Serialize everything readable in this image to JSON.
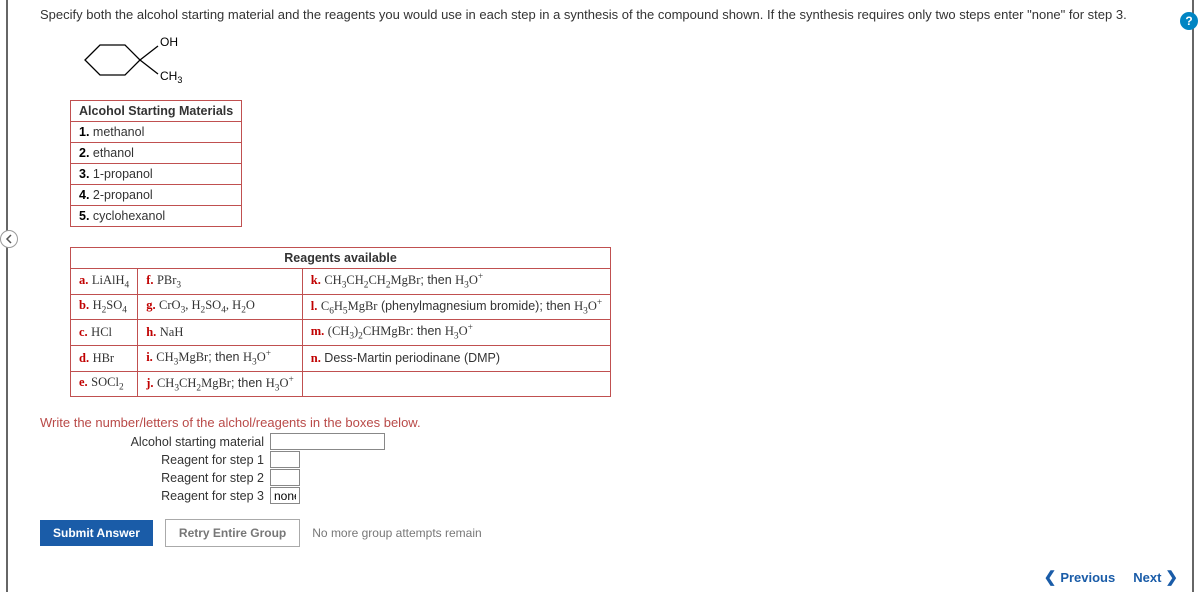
{
  "question": "Specify both the alcohol starting material and the reagents you would use in each step in a synthesis of the compound shown. If the synthesis requires only two steps enter \"none\" for step 3.",
  "structure": {
    "oh": "OH",
    "ch3": "CH₃"
  },
  "materials": {
    "header": "Alcohol Starting Materials",
    "rows": [
      {
        "num": "1.",
        "name": "methanol"
      },
      {
        "num": "2.",
        "name": "ethanol"
      },
      {
        "num": "3.",
        "name": "1-propanol"
      },
      {
        "num": "4.",
        "name": "2-propanol"
      },
      {
        "num": "5.",
        "name": "cyclohexanol"
      }
    ]
  },
  "reagents": {
    "header": "Reagents available",
    "rows": [
      {
        "c1l": "a.",
        "c1t": "LiAlH₄",
        "c2l": "f.",
        "c2t": "PBr₃",
        "c3l": "k.",
        "c3t": "CH₃CH₂CH₂MgBr; then H₃O⁺"
      },
      {
        "c1l": "b.",
        "c1t": "H₂SO₄",
        "c2l": "g.",
        "c2t": "CrO₃, H₂SO₄, H₂O",
        "c3l": "l.",
        "c3t": "C₆H₅MgBr (phenylmagnesium bromide); then H₃O⁺"
      },
      {
        "c1l": "c.",
        "c1t": "HCl",
        "c2l": "h.",
        "c2t": "NaH",
        "c3l": "m.",
        "c3t": "(CH₃)₂CHMgBr: then H₃O⁺"
      },
      {
        "c1l": "d.",
        "c1t": "HBr",
        "c2l": "i.",
        "c2t": "CH₃MgBr; then H₃O⁺",
        "c3l": "n.",
        "c3t": "Dess-Martin periodinane (DMP)"
      },
      {
        "c1l": "e.",
        "c1t": "SOCl₂",
        "c2l": "j.",
        "c2t": "CH₃CH₂MgBr; then H₃O⁺",
        "c3l": "",
        "c3t": ""
      }
    ]
  },
  "instruction": "Write the number/letters of the alchol/reagents in the boxes below.",
  "answers": {
    "starting_label": "Alcohol starting material",
    "step1_label": "Reagent for step 1",
    "step2_label": "Reagent for step 2",
    "step3_label": "Reagent for step 3",
    "starting_value": "",
    "step1_value": "",
    "step2_value": "",
    "step3_value": "none"
  },
  "buttons": {
    "submit": "Submit Answer",
    "retry": "Retry Entire Group",
    "attempts": "No more group attempts remain"
  },
  "nav": {
    "prev": "Previous",
    "next": "Next"
  },
  "help": "?"
}
